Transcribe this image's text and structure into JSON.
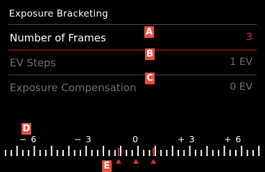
{
  "menu": {
    "title": "Exposure Bracketing",
    "items": [
      {
        "label": "Number of Frames",
        "value": "3",
        "state": "active"
      },
      {
        "label": "EV Steps",
        "value": "1 EV",
        "state": "inactive"
      },
      {
        "label": "Exposure Compensation",
        "value": "0 EV",
        "state": "inactive"
      }
    ]
  },
  "scale": {
    "labels": [
      "− 6",
      "− 3",
      "0",
      "+ 3",
      "+ 6"
    ],
    "markers": [
      "-1",
      "0",
      "+1"
    ]
  },
  "callouts": {
    "a": "A",
    "b": "B",
    "c": "C",
    "d": "D",
    "e": "E"
  },
  "colors": {
    "background": "#000000",
    "active_text": "#ffffff",
    "active_value": "#e0301e",
    "inactive_text": "#6f6f6f",
    "accent_red": "#c8281e",
    "callout": "#ea4c3c"
  }
}
